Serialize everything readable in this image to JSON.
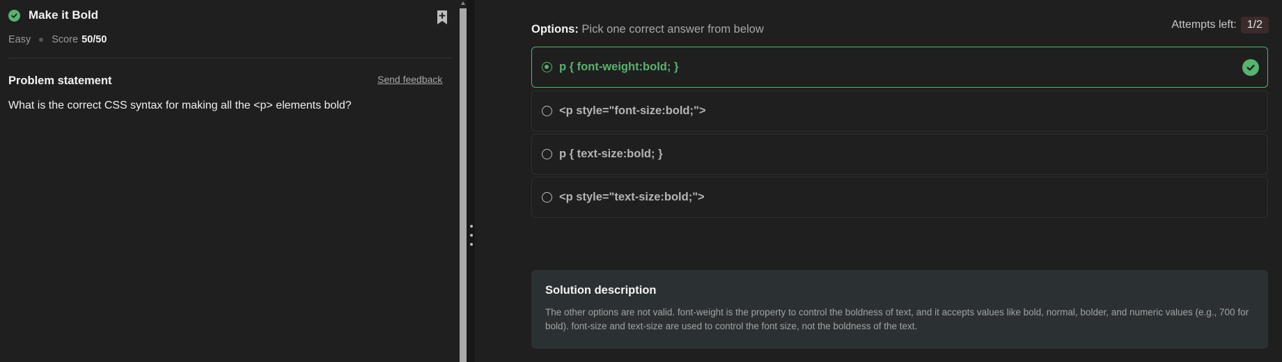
{
  "problem": {
    "title": "Make it Bold",
    "difficulty": "Easy",
    "score_label": "Score",
    "score_value": "50/50",
    "statement_title": "Problem statement",
    "feedback_label": "Send feedback",
    "statement_text": "What is the correct CSS syntax for making all the <p> elements bold?"
  },
  "options_panel": {
    "heading": "Options:",
    "subheading": "Pick one correct answer from below",
    "attempts_label": "Attempts left:",
    "attempts_value": "1/2",
    "options": [
      {
        "label": "p { font-weight:bold; }",
        "selected": true,
        "correct": true
      },
      {
        "label": "<p style=\"font-size:bold;\">",
        "selected": false
      },
      {
        "label": "p { text-size:bold; }",
        "selected": false
      },
      {
        "label": "<p style=\"text-size:bold;\">",
        "selected": false
      }
    ]
  },
  "solution": {
    "title": "Solution description",
    "text": "The other options are not valid. font-weight is the property to control the boldness of text, and it accepts values like bold, normal, bolder, and numeric values (e.g., 700 for bold). font-size and text-size are used to control the font size, not the boldness of the text."
  },
  "colors": {
    "accent_green": "#56b46e",
    "background": "#1f1f1f",
    "solution_bg": "#2b3133",
    "attempts_pill": "#3b2a2b"
  }
}
